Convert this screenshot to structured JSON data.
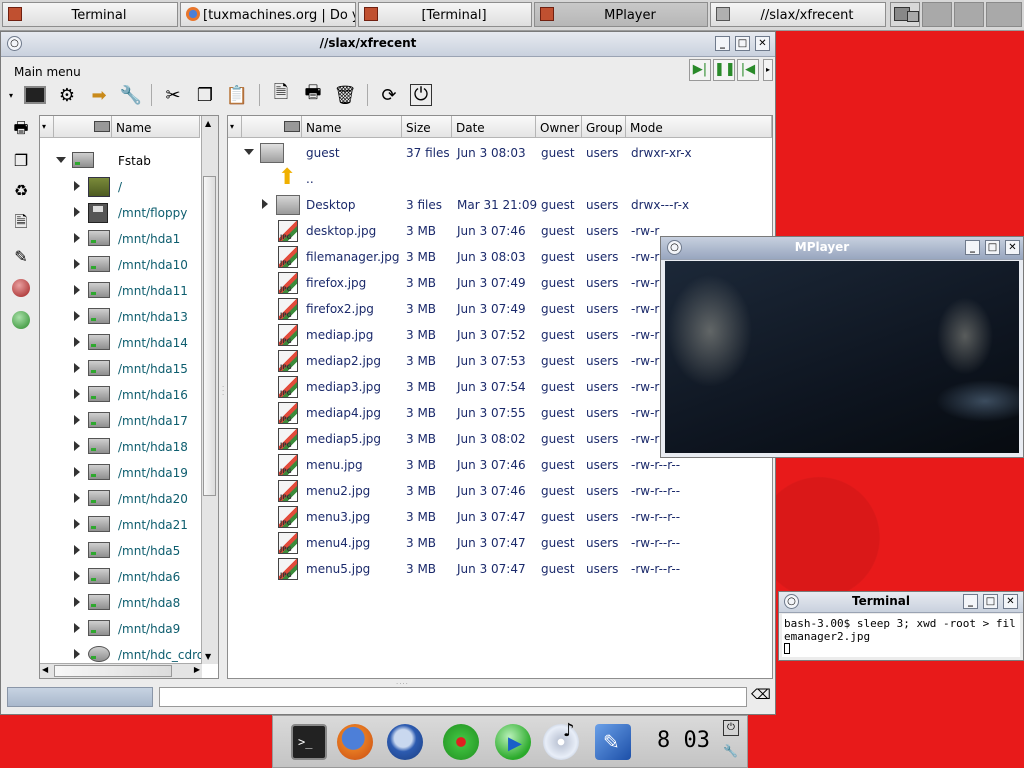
{
  "taskbar": {
    "tasks": [
      {
        "label": "Terminal"
      },
      {
        "label": "[tuxmachines.org | Do you"
      },
      {
        "label": "[Terminal]"
      },
      {
        "label": "MPlayer"
      },
      {
        "label": "//slax/xfrecent"
      }
    ]
  },
  "fm": {
    "title": "//slax/xfrecent",
    "menu": "Main menu",
    "tree_header": {
      "name": "Name"
    },
    "tree_root": "Fstab",
    "tree_items": [
      "/",
      "/mnt/floppy",
      "/mnt/hda1",
      "/mnt/hda10",
      "/mnt/hda11",
      "/mnt/hda13",
      "/mnt/hda14",
      "/mnt/hda15",
      "/mnt/hda16",
      "/mnt/hda17",
      "/mnt/hda18",
      "/mnt/hda19",
      "/mnt/hda20",
      "/mnt/hda21",
      "/mnt/hda5",
      "/mnt/hda6",
      "/mnt/hda8",
      "/mnt/hda9",
      "/mnt/hdc_cdrom"
    ],
    "columns": {
      "name": "Name",
      "size": "Size",
      "date": "Date",
      "owner": "Owner",
      "group": "Group",
      "mode": "Mode"
    },
    "rows": [
      {
        "name": "guest",
        "size": "37 files",
        "date": "Jun  3 08:03",
        "owner": "guest",
        "group": "users",
        "mode": "drwxr-xr-x"
      },
      {
        "name": "..",
        "size": "",
        "date": "",
        "owner": "",
        "group": "",
        "mode": ""
      },
      {
        "name": "Desktop",
        "size": "3 files",
        "date": "Mar 31 21:09",
        "owner": "guest",
        "group": "users",
        "mode": "drwx---r-x"
      },
      {
        "name": "desktop.jpg",
        "size": "3 MB",
        "date": "Jun  3 07:46",
        "owner": "guest",
        "group": "users",
        "mode": "-rw-r"
      },
      {
        "name": "filemanager.jpg",
        "size": "3 MB",
        "date": "Jun  3 08:03",
        "owner": "guest",
        "group": "users",
        "mode": "-rw-r"
      },
      {
        "name": "firefox.jpg",
        "size": "3 MB",
        "date": "Jun  3 07:49",
        "owner": "guest",
        "group": "users",
        "mode": "-rw-r"
      },
      {
        "name": "firefox2.jpg",
        "size": "3 MB",
        "date": "Jun  3 07:49",
        "owner": "guest",
        "group": "users",
        "mode": "-rw-r"
      },
      {
        "name": "mediap.jpg",
        "size": "3 MB",
        "date": "Jun  3 07:52",
        "owner": "guest",
        "group": "users",
        "mode": "-rw-r"
      },
      {
        "name": "mediap2.jpg",
        "size": "3 MB",
        "date": "Jun  3 07:53",
        "owner": "guest",
        "group": "users",
        "mode": "-rw-r"
      },
      {
        "name": "mediap3.jpg",
        "size": "3 MB",
        "date": "Jun  3 07:54",
        "owner": "guest",
        "group": "users",
        "mode": "-rw-r"
      },
      {
        "name": "mediap4.jpg",
        "size": "3 MB",
        "date": "Jun  3 07:55",
        "owner": "guest",
        "group": "users",
        "mode": "-rw-r"
      },
      {
        "name": "mediap5.jpg",
        "size": "3 MB",
        "date": "Jun  3 08:02",
        "owner": "guest",
        "group": "users",
        "mode": "-rw-r"
      },
      {
        "name": "menu.jpg",
        "size": "3 MB",
        "date": "Jun  3 07:46",
        "owner": "guest",
        "group": "users",
        "mode": "-rw-r--r--"
      },
      {
        "name": "menu2.jpg",
        "size": "3 MB",
        "date": "Jun  3 07:46",
        "owner": "guest",
        "group": "users",
        "mode": "-rw-r--r--"
      },
      {
        "name": "menu3.jpg",
        "size": "3 MB",
        "date": "Jun  3 07:47",
        "owner": "guest",
        "group": "users",
        "mode": "-rw-r--r--"
      },
      {
        "name": "menu4.jpg",
        "size": "3 MB",
        "date": "Jun  3 07:47",
        "owner": "guest",
        "group": "users",
        "mode": "-rw-r--r--"
      },
      {
        "name": "menu5.jpg",
        "size": "3 MB",
        "date": "Jun  3 07:47",
        "owner": "guest",
        "group": "users",
        "mode": "-rw-r--r--"
      }
    ]
  },
  "mplayer": {
    "title": "MPlayer"
  },
  "terminal": {
    "title": "Terminal",
    "text": "bash-3.00$ sleep 3; xwd -root > filemanager2.jpg"
  },
  "dock": {
    "clock": "8 03"
  },
  "colors": {
    "desktop": "#e81a1a",
    "link": "#0d5d6e",
    "text_navy": "#1b2a6b"
  }
}
